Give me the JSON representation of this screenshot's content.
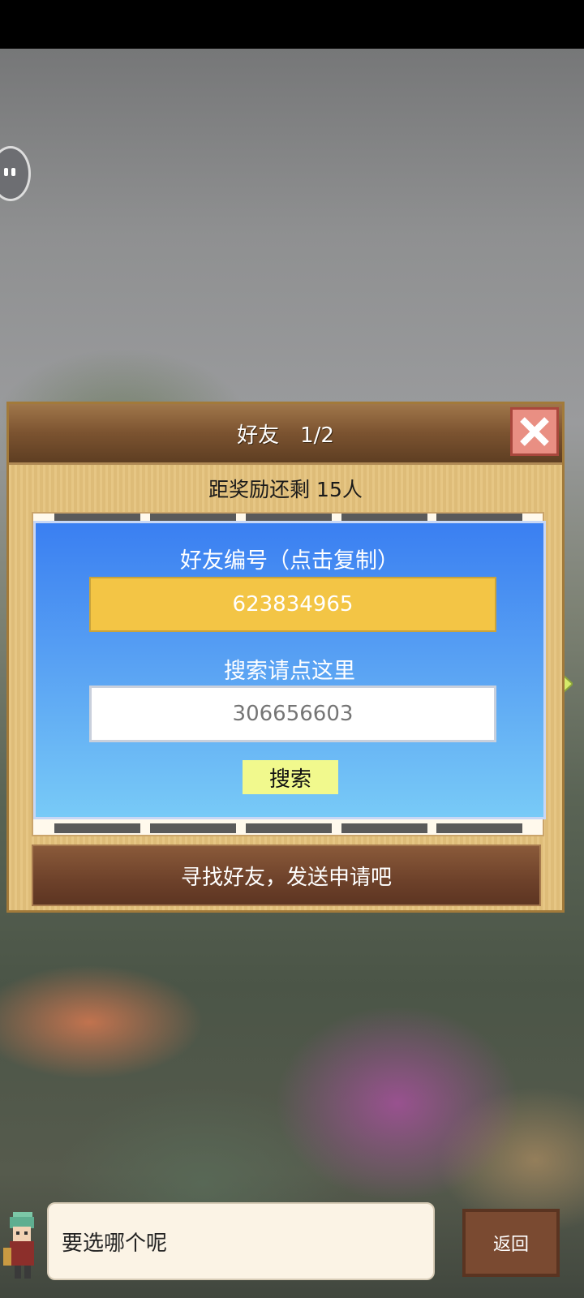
{
  "dialog": {
    "title": "好友　1/2",
    "reward_text": "距奖励还剩 15人",
    "friend_id_label": "好友编号（点击复制）",
    "friend_id": "623834965",
    "search_label": "搜索请点这里",
    "search_placeholder": "306656603",
    "search_button": "搜索",
    "banner": "寻找好友，发送申请吧"
  },
  "footer": {
    "prompt": "要选哪个呢",
    "back_button": "返回"
  },
  "icons": {
    "close": "close-icon",
    "left_arrow": "arrow-left-icon",
    "right_arrow": "arrow-right-icon",
    "chat": "chat-bubble-icon"
  }
}
